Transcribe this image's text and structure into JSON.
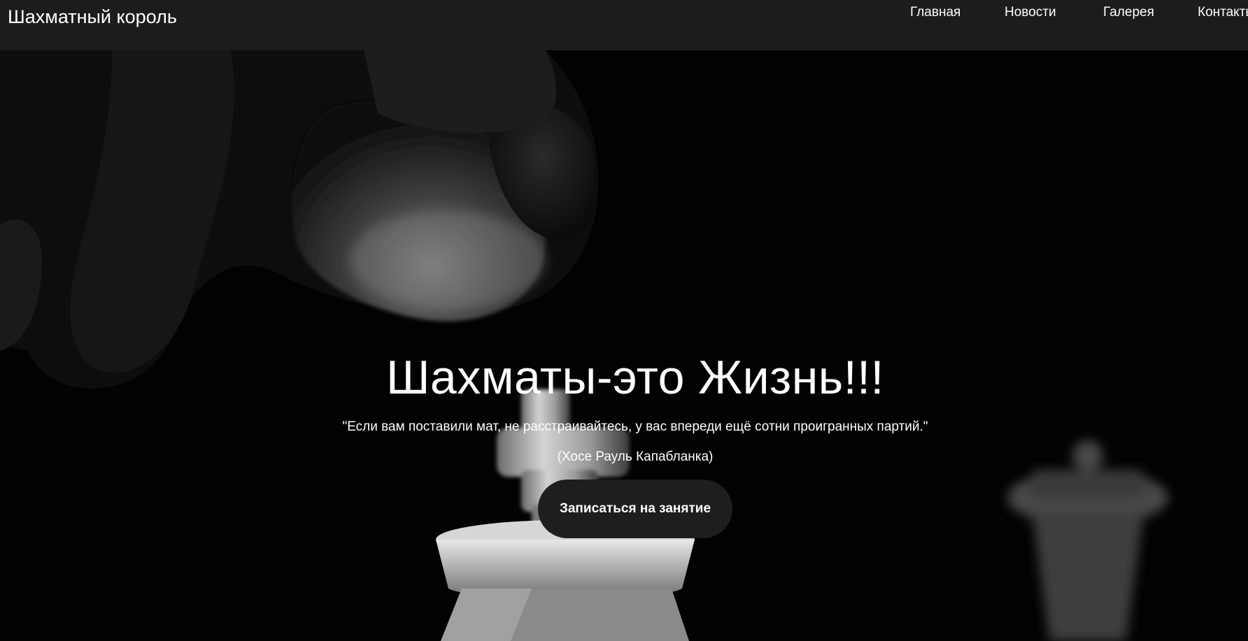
{
  "header": {
    "brand": "Шахматный король",
    "nav": [
      "Главная",
      "Новости",
      "Галерея",
      "Контакты"
    ]
  },
  "hero": {
    "title": "Шахматы-это Жизнь!!!",
    "quote": "\"Если вам поставили мат, не расстраивайтесь, у вас впереди ещё сотни проигранных партий.\"",
    "author": "(Хосе Рауль Капабланка)",
    "cta_label": "Записаться на занятие"
  },
  "colors": {
    "header_bg": "#1c1c1c",
    "hero_bg": "#020202",
    "button_bg": "#1e1e1e",
    "text": "#ffffff"
  }
}
